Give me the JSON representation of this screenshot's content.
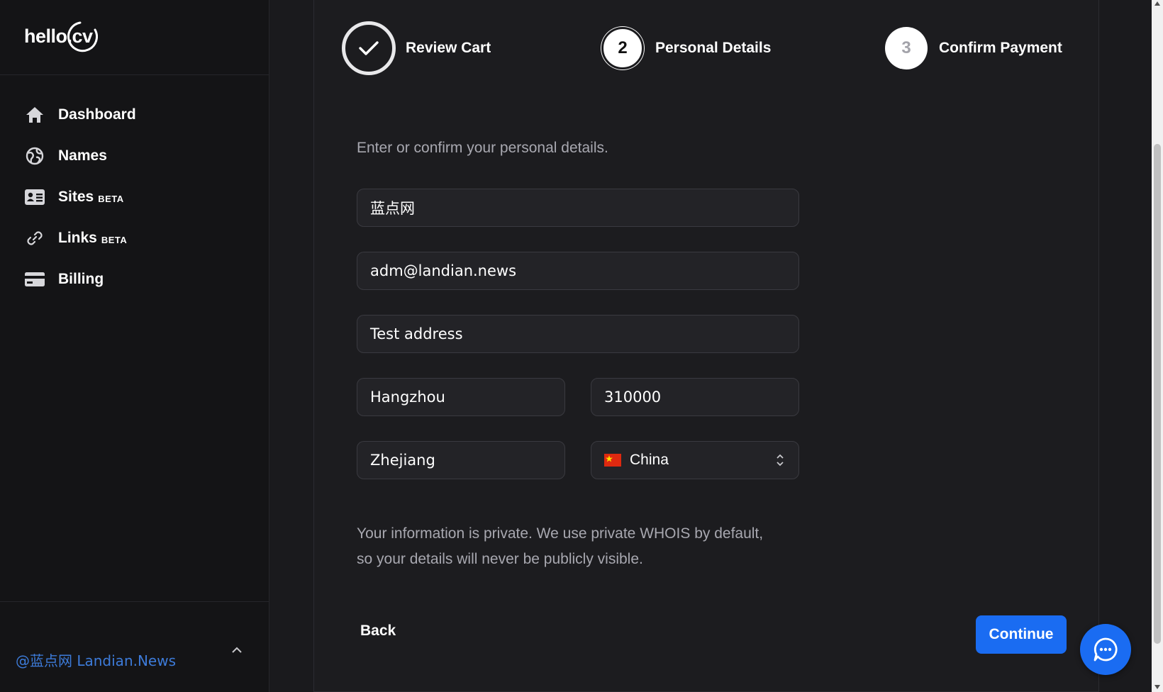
{
  "app": {
    "logo_text": "hello.cv"
  },
  "sidebar": {
    "items": [
      {
        "label": "Dashboard",
        "badge": "",
        "icon": "home-icon"
      },
      {
        "label": "Names",
        "badge": "",
        "icon": "globe-icon"
      },
      {
        "label": "Sites",
        "badge": "BETA",
        "icon": "id-card-icon"
      },
      {
        "label": "Links",
        "badge": "BETA",
        "icon": "link-icon"
      },
      {
        "label": "Billing",
        "badge": "",
        "icon": "credit-card-icon"
      }
    ],
    "watermark": "@蓝点网 Landian.News"
  },
  "steps": [
    {
      "number": "",
      "label": "Review Cart",
      "state": "complete"
    },
    {
      "number": "2",
      "label": "Personal Details",
      "state": "current"
    },
    {
      "number": "3",
      "label": "Confirm Payment",
      "state": "upcoming"
    }
  ],
  "form": {
    "intro": "Enter or confirm your personal details.",
    "name": "蓝点网",
    "email": "adm@landian.news",
    "address": "Test address",
    "city": "Hangzhou",
    "postal_code": "310000",
    "state": "Zhejiang",
    "country": "China",
    "privacy_line1": "Your information is private. We use private WHOIS by default,",
    "privacy_line2": "so your details will never be publicly visible."
  },
  "actions": {
    "back": "Back",
    "continue": "Continue"
  },
  "colors": {
    "accent": "#1a6cf2",
    "background": "#1a1a1d",
    "sidebar": "#141416",
    "muted_text": "#a8a8b0",
    "watermark": "#3d7bd9"
  }
}
